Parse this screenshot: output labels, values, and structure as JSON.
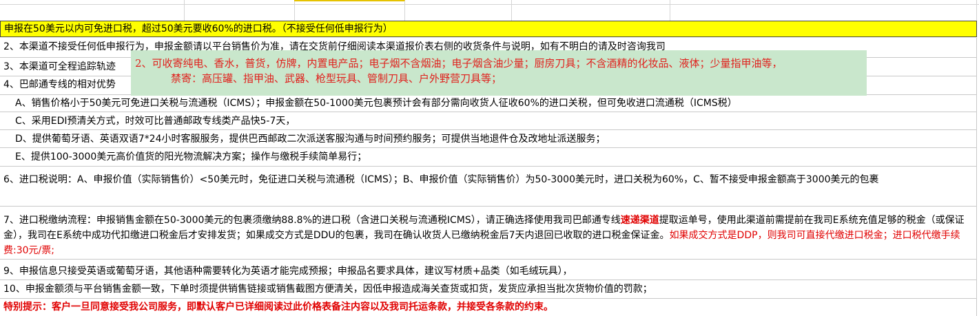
{
  "rows": {
    "r0": "申报在50美元以内可免进口税，超过50美元要收60%的进口税。（不接受任何低申报行为）",
    "r1": "2、本渠道不接受任何低申报行为，申报金额请以平台销售价为准，请在交货前仔细阅读本渠道报价表右侧的收货条件与说明，如有不明白的请及时咨询我司",
    "r2": "3、本渠道可全程追踪轨迹",
    "r3": "4、巴邮通专线的相对优势",
    "a": "A、销售价格小于50美元可免进口关税与流通税（ICMS）；申报金额在50-1000美元包裹预计会有部分需向收货人征收60%的进口关税，但可免收进口流通税（ICMS税）",
    "c": "C、采用EDI预清关方式，时效可比普通邮政专线类产品快5-7天，",
    "d": "D、提供葡萄牙语、英语双语7*24小时客服服务，提供巴西邮政二次派送客服沟通与时间预约服务；可提供当地退件仓及改地址派送服务；",
    "e": "E、提供100-3000美元高价值货的阳光物流解决方案；操作与缴税手续简单易行；",
    "r6": "6、进口税说明：A、申报价值（实际销售价）<50美元时，免征进口关税与流通税（ICMS）；B、申报价值（实际销售价）为50-3000美元时，进口关税为60%，C、暂不接受申报金额高于3000美元的包裹",
    "r7a": "7、进口税缴纳流程：申报销售金额在50-3000美元的包裹须缴纳88.8%的进口税（含进口关税与流通税ICMS），请正确选择使用我司巴邮通专线",
    "r7red": "速递渠道",
    "r7b": "提取运单号，使用此渠道前需提前在我司E系统充值足够的税金（或保证金），我司在E系统中成功代扣缴进口税金后才安排发货；如果成交方式是DDU的包裹，我司在确认收货人已缴纳税金后7天内退回已收取的进口税金保证金。",
    "r7c": "如果成交方式是DDP，则我司可直接代缴进口税金；进口税代缴手续费:30元/票;",
    "r9": "9、申报信息只接受英语或葡萄牙语，其他语种需要转化为英语才能完成预报；申报品名要求具体，建议写材质+品类（如毛绒玩具），",
    "r10": "10、申报金额须与平台销售金额一致，下单时须提供销售链接或销售截图方便清关，因低申报造成海关查货或扣货，发货应承担当批次货物价值的罚款；",
    "special": "特别提示：客户一旦同意接受我公司服务，即默认客户已详细阅读过此价格表备注内容以及我司托运条款，并接受各条款的约束。"
  },
  "popup": {
    "line1": "2、可收寄纯电、香水，普货，仿牌，内置电产品；电子烟不含烟油；电子烟含油少量；厨房刀具；不含酒精的化妆品、液体；少量指甲油等，",
    "line2": "禁寄：高压罐、指甲油、武器、枪型玩具、管制刀具、户外野营刀具等；"
  }
}
